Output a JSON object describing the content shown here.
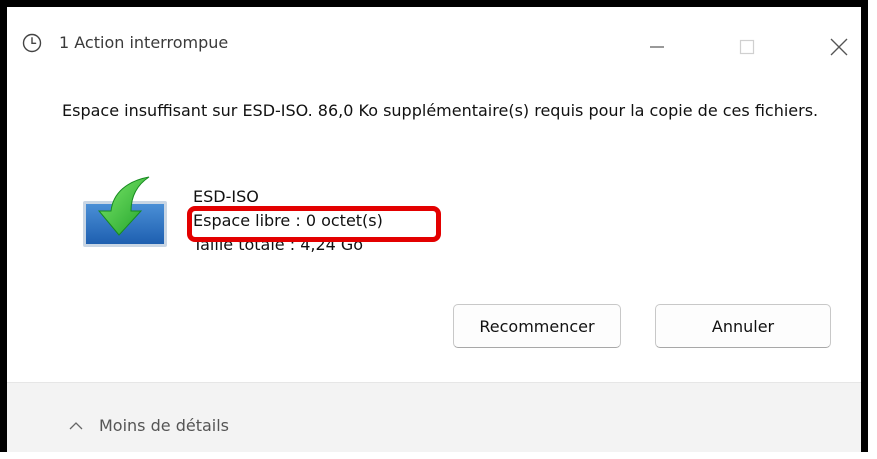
{
  "window": {
    "title": "1 Action interrompue",
    "title_icon": "clock-icon",
    "controls": {
      "minimize_icon": "minimize-icon",
      "maximize_icon": "maximize-icon",
      "close_icon": "close-icon"
    }
  },
  "dialog": {
    "message": "Espace insuffisant sur ESD-ISO. 86,0 Ko supplémentaire(s) requis pour la copie de ces fichiers.",
    "drive": {
      "icon": "drive-download-icon",
      "name": "ESD-ISO",
      "free_space": "Espace libre : 0 octet(s)",
      "total_size": "Taille totale : 4,24 Go"
    },
    "highlight_color": "#e30000",
    "buttons": {
      "retry": "Recommencer",
      "cancel": "Annuler"
    }
  },
  "footer": {
    "toggle_icon": "chevron-up-icon",
    "toggle_label": "Moins de détails"
  }
}
